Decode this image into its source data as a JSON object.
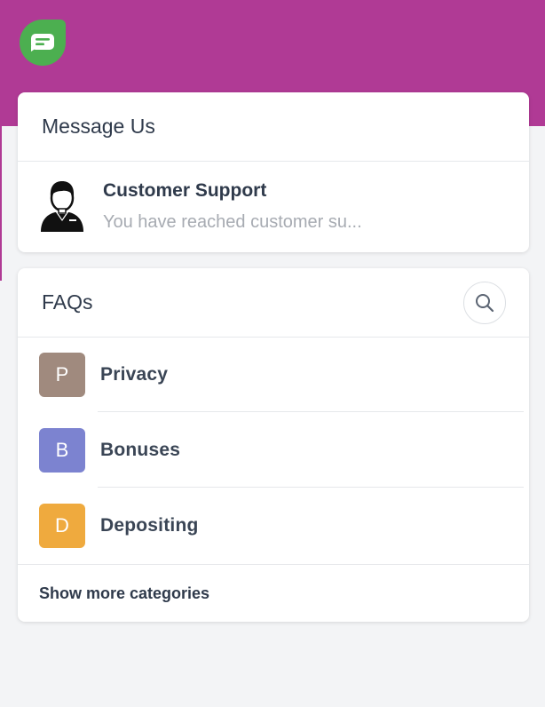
{
  "brand": {
    "logo_icon": "chat-bubble-icon",
    "banner_color": "#b03a95",
    "logo_color": "#4caf50"
  },
  "message_card": {
    "title": "Message Us",
    "support": {
      "avatar_icon": "support-agent-icon",
      "name": "Customer Support",
      "preview": "You have reached customer su..."
    }
  },
  "faq_card": {
    "title": "FAQs",
    "search_icon": "search-icon",
    "items": [
      {
        "letter": "P",
        "label": "Privacy",
        "color": "#a08a7e"
      },
      {
        "letter": "B",
        "label": "Bonuses",
        "color": "#7c83d0"
      },
      {
        "letter": "D",
        "label": "Depositing",
        "color": "#efaa3e"
      }
    ],
    "show_more": "Show more categories"
  }
}
